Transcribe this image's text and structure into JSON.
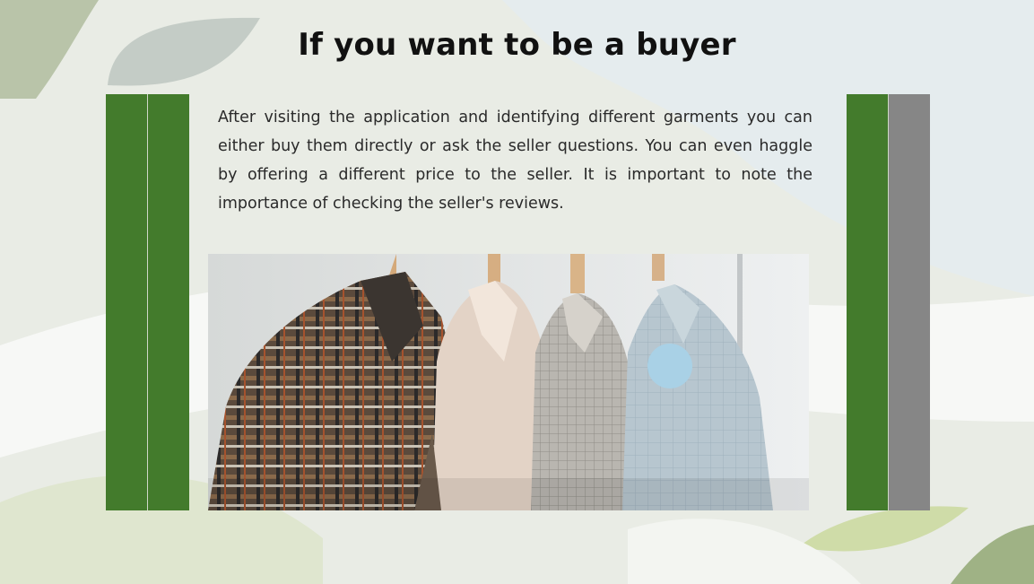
{
  "slide": {
    "title": "If you want to be a buyer",
    "body": "After visiting the application and identifying different garments you can either buy them directly or ask the seller questions. You can even haggle by offering a different price to the seller. It is important to note the importance of checking the seller's reviews.",
    "image_subject": "garments-on-hangers-photo"
  },
  "colors": {
    "green_bar": "#437b2c",
    "gray_bar": "#868686",
    "title": "#111111",
    "text": "#2a2a2a"
  }
}
